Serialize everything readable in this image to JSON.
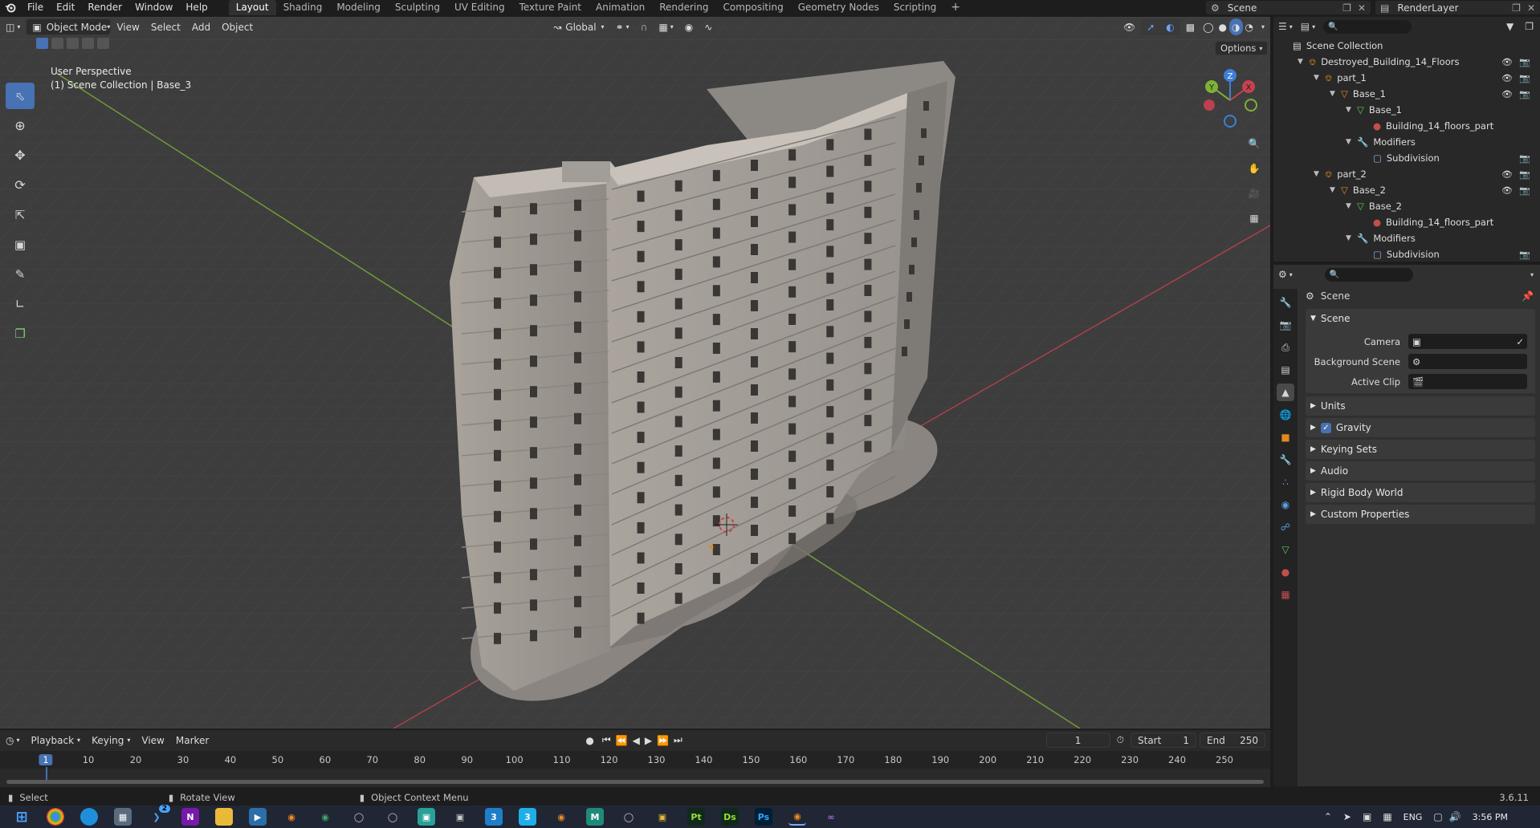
{
  "menus": [
    "File",
    "Edit",
    "Render",
    "Window",
    "Help"
  ],
  "workspaces": [
    "Layout",
    "Shading",
    "Modeling",
    "Sculpting",
    "UV Editing",
    "Texture Paint",
    "Animation",
    "Rendering",
    "Compositing",
    "Geometry Nodes",
    "Scripting"
  ],
  "active_workspace": "Layout",
  "scene_field": "Scene",
  "render_layer_field": "RenderLayer",
  "viewport": {
    "mode": "Object Mode",
    "menus": [
      "View",
      "Select",
      "Add",
      "Object"
    ],
    "orientation": "Global",
    "options_label": "Options",
    "perspective_label": "User Perspective",
    "context_label": "(1) Scene Collection | Base_3",
    "gizmo": {
      "x": "X",
      "y": "Y",
      "z": "Z"
    }
  },
  "outliner": {
    "rows": [
      {
        "label": "Scene Collection",
        "icon": "collection-icon",
        "depth": 0,
        "expanded": null,
        "vis": false
      },
      {
        "label": "Destroyed_Building_14_Floors",
        "icon": "empty-icon",
        "depth": 1,
        "expanded": true,
        "vis": true
      },
      {
        "label": "part_1",
        "icon": "empty-icon",
        "depth": 2,
        "expanded": true,
        "vis": true
      },
      {
        "label": "Base_1",
        "icon": "mesh-object-icon",
        "depth": 3,
        "expanded": true,
        "vis": true
      },
      {
        "label": "Base_1",
        "icon": "mesh-data-icon",
        "depth": 4,
        "expanded": true,
        "vis": false
      },
      {
        "label": "Building_14_floors_part",
        "icon": "material-icon",
        "depth": 5,
        "expanded": null,
        "vis": false
      },
      {
        "label": "Modifiers",
        "icon": "wrench-icon",
        "depth": 4,
        "expanded": true,
        "vis": false
      },
      {
        "label": "Subdivision",
        "icon": "subdivision-icon",
        "depth": 5,
        "expanded": null,
        "vis": "cam"
      },
      {
        "label": "part_2",
        "icon": "empty-icon",
        "depth": 2,
        "expanded": true,
        "vis": true
      },
      {
        "label": "Base_2",
        "icon": "mesh-object-icon",
        "depth": 3,
        "expanded": true,
        "vis": true
      },
      {
        "label": "Base_2",
        "icon": "mesh-data-icon",
        "depth": 4,
        "expanded": true,
        "vis": false
      },
      {
        "label": "Building_14_floors_part",
        "icon": "material-icon",
        "depth": 5,
        "expanded": null,
        "vis": false
      },
      {
        "label": "Modifiers",
        "icon": "wrench-icon",
        "depth": 4,
        "expanded": true,
        "vis": false
      },
      {
        "label": "Subdivision",
        "icon": "subdivision-icon",
        "depth": 5,
        "expanded": null,
        "vis": "cam"
      }
    ]
  },
  "properties": {
    "breadcrumb": "Scene",
    "scene_panel_title": "Scene",
    "fields": [
      {
        "label": "Camera",
        "value": ""
      },
      {
        "label": "Background Scene",
        "value": ""
      },
      {
        "label": "Active Clip",
        "value": ""
      }
    ],
    "collapsed_panels": [
      "Units",
      "Gravity",
      "Keying Sets",
      "Audio",
      "Rigid Body World",
      "Custom Properties"
    ],
    "gravity_checked": true
  },
  "timeline": {
    "menus": [
      "Playback",
      "Keying",
      "View",
      "Marker"
    ],
    "current_frame": "1",
    "start_label": "Start",
    "start_value": "1",
    "end_label": "End",
    "end_value": "250",
    "ruler": [
      "1",
      "10",
      "20",
      "30",
      "40",
      "50",
      "60",
      "70",
      "80",
      "90",
      "100",
      "110",
      "120",
      "130",
      "140",
      "150",
      "160",
      "170",
      "180",
      "190",
      "200",
      "210",
      "220",
      "230",
      "240",
      "250"
    ]
  },
  "status": {
    "select": "Select",
    "rotate": "Rotate View",
    "context_menu": "Object Context Menu",
    "version": "3.6.11"
  },
  "taskbar": {
    "lang": "ENG",
    "time": "3:56 PM",
    "badge": "2",
    "apps": [
      "Pt",
      "Ds",
      "Ps"
    ]
  },
  "colors": {
    "accent": "#4772b3",
    "x_axis": "#c8414f",
    "y_axis": "#7eb235",
    "z_axis": "#3f7fd9"
  }
}
